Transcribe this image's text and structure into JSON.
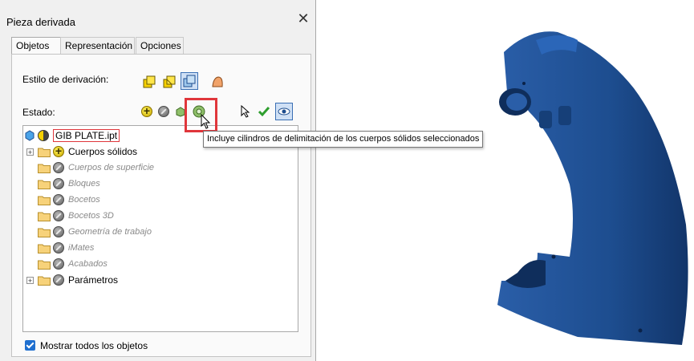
{
  "dialog": {
    "title": "Pieza derivada",
    "close_glyph": "✕",
    "tabs": [
      {
        "label": "Objetos",
        "active": true
      },
      {
        "label": "Representación",
        "active": false
      },
      {
        "label": "Opciones",
        "active": false
      }
    ],
    "derivation_style_label": "Estilo de derivación:",
    "state_label": "Estado:",
    "tree": {
      "root": {
        "label": "GIB PLATE.ipt"
      },
      "items": [
        {
          "label": "Cuerpos sólidos",
          "state": "include",
          "expandable": true,
          "italic": false
        },
        {
          "label": "Cuerpos de superficie",
          "state": "exclude",
          "expandable": false,
          "italic": true
        },
        {
          "label": "Bloques",
          "state": "exclude",
          "expandable": false,
          "italic": true
        },
        {
          "label": "Bocetos",
          "state": "exclude",
          "expandable": false,
          "italic": true
        },
        {
          "label": "Bocetos 3D",
          "state": "exclude",
          "expandable": false,
          "italic": true
        },
        {
          "label": "Geometría de trabajo",
          "state": "exclude",
          "expandable": false,
          "italic": true
        },
        {
          "label": "iMates",
          "state": "exclude",
          "expandable": false,
          "italic": true
        },
        {
          "label": "Acabados",
          "state": "exclude",
          "expandable": false,
          "italic": true
        },
        {
          "label": "Parámetros",
          "state": "exclude",
          "expandable": true,
          "italic": false
        }
      ]
    },
    "show_all_label": "Mostrar todos los objetos",
    "show_all_checked": true
  },
  "tooltip": {
    "text": "Incluye cilindros de delimitación de los cuerpos sólidos seleccionados"
  },
  "colors": {
    "model_blue": "#1d4d8f",
    "highlight_red": "#e0363b",
    "accent_blue": "#1f6fcf"
  }
}
